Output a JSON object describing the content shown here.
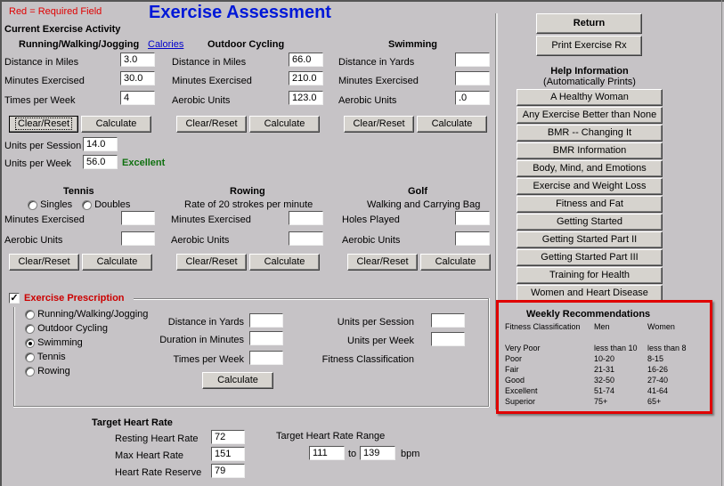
{
  "header": {
    "required_note": "Red = Required Field",
    "title": "Exercise Assessment"
  },
  "current_activity": {
    "heading": "Current Exercise Activity",
    "running": {
      "title": "Running/Walking/Jogging",
      "calories_link": "Calories",
      "distance_label": "Distance in Miles",
      "distance_value": "3.0",
      "minutes_label": "Minutes Exercised",
      "minutes_value": "30.0",
      "times_label": "Times per Week",
      "times_value": "4",
      "clear_label": "Clear/Reset",
      "calc_label": "Calculate",
      "units_session_label": "Units per Session",
      "units_session_value": "14.0",
      "units_week_label": "Units per Week",
      "units_week_value": "56.0",
      "rating": "Excellent"
    },
    "cycling": {
      "title": "Outdoor Cycling",
      "distance_label": "Distance in Miles",
      "distance_value": "66.0",
      "minutes_label": "Minutes Exercised",
      "minutes_value": "210.0",
      "aerobic_label": "Aerobic Units",
      "aerobic_value": "123.0",
      "clear_label": "Clear/Reset",
      "calc_label": "Calculate"
    },
    "swimming": {
      "title": "Swimming",
      "distance_label": "Distance in Yards",
      "distance_value": "",
      "minutes_label": "Minutes Exercised",
      "minutes_value": "",
      "aerobic_label": "Aerobic Units",
      "aerobic_value": ".0",
      "clear_label": "Clear/Reset",
      "calc_label": "Calculate"
    },
    "tennis": {
      "title": "Tennis",
      "singles_label": "Singles",
      "doubles_label": "Doubles",
      "minutes_label": "Minutes Exercised",
      "minutes_value": "",
      "aerobic_label": "Aerobic Units",
      "aerobic_value": "",
      "clear_label": "Clear/Reset",
      "calc_label": "Calculate"
    },
    "rowing": {
      "title": "Rowing",
      "subtitle": "Rate of 20 strokes per minute",
      "minutes_label": "Minutes Exercised",
      "minutes_value": "",
      "aerobic_label": "Aerobic Units",
      "aerobic_value": "",
      "clear_label": "Clear/Reset",
      "calc_label": "Calculate"
    },
    "golf": {
      "title": "Golf",
      "subtitle": "Walking and Carrying Bag",
      "holes_label": "Holes Played",
      "holes_value": "",
      "aerobic_label": "Aerobic Units",
      "aerobic_value": "",
      "clear_label": "Clear/Reset",
      "calc_label": "Calculate"
    }
  },
  "prescription": {
    "title": "Exercise Prescription",
    "checked": true,
    "options": [
      {
        "label": "Running/Walking/Jogging",
        "selected": false
      },
      {
        "label": "Outdoor Cycling",
        "selected": false
      },
      {
        "label": "Swimming",
        "selected": true
      },
      {
        "label": "Tennis",
        "selected": false
      },
      {
        "label": "Rowing",
        "selected": false
      }
    ],
    "distance_label": "Distance in Yards",
    "distance_value": "",
    "duration_label": "Duration in Minutes",
    "duration_value": "",
    "times_label": "Times per Week",
    "times_value": "",
    "calc_label": "Calculate",
    "units_session_label": "Units per Session",
    "units_session_value": "",
    "units_week_label": "Units per Week",
    "units_week_value": "",
    "fitness_class_label": "Fitness Classification"
  },
  "heart_rate": {
    "title": "Target Heart Rate",
    "resting_label": "Resting Heart Rate",
    "resting_value": "72",
    "max_label": "Max Heart Rate",
    "max_value": "151",
    "reserve_label": "Heart Rate Reserve",
    "reserve_value": "79",
    "range_label": "Target Heart Rate Range",
    "range_low": "111",
    "range_to": "to",
    "range_high": "139",
    "range_unit": "bpm"
  },
  "sidebar": {
    "return_label": "Return",
    "print_label": "Print Exercise Rx",
    "help_title": "Help Information",
    "help_subtitle": "(Automatically Prints)",
    "help_items": [
      "A Healthy Woman",
      "Any Exercise Better than None",
      "BMR -- Changing It",
      "BMR Information",
      "Body, Mind, and Emotions",
      "Exercise and Weight Loss",
      "Fitness and Fat",
      "Getting Started",
      "Getting Started Part II",
      "Getting Started Part III",
      "Training for Health",
      "Women and Heart Disease"
    ]
  },
  "recommendations": {
    "title": "Weekly Recommendations",
    "headers": [
      "Fitness Classification",
      "Men",
      "Women"
    ],
    "rows": [
      [
        "Very Poor",
        "less than 10",
        "less than 8"
      ],
      [
        "Poor",
        "10-20",
        "8-15"
      ],
      [
        "Fair",
        "21-31",
        "16-26"
      ],
      [
        "Good",
        "32-50",
        "27-40"
      ],
      [
        "Excellent",
        "51-74",
        "41-64"
      ],
      [
        "Superior",
        "75+",
        "65+"
      ]
    ]
  },
  "colors": {
    "background": "#c6c3c6",
    "title": "#0018d8",
    "required": "#e00000",
    "excellent": "#107010",
    "highlight_border": "#e00000"
  }
}
